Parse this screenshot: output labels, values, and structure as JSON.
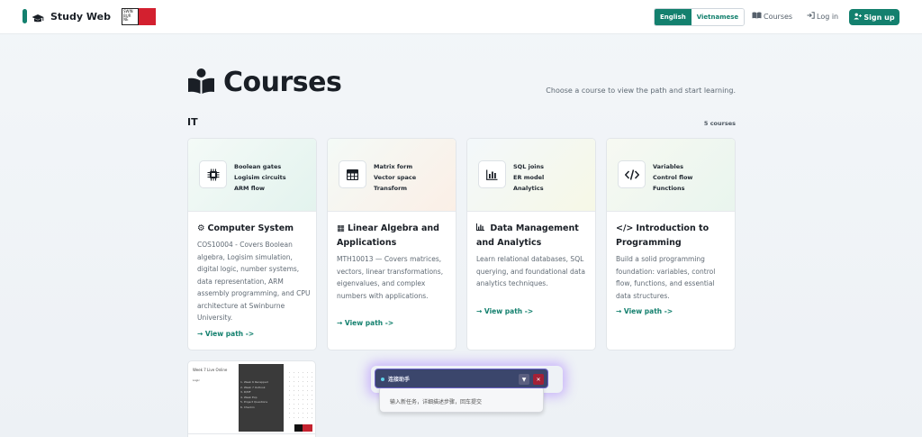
{
  "nav": {
    "brand": "Study Web",
    "logo_text": "SWIN BUR NE",
    "lang_english": "English",
    "lang_vietnamese": "Vietnamese",
    "courses": "Courses",
    "login": "Log in",
    "signup": "Sign up"
  },
  "header": {
    "title": "Courses",
    "subtitle": "Choose a course to view the path and start learning."
  },
  "section": {
    "name": "IT",
    "count": "5 courses"
  },
  "cards": [
    {
      "icon": "chip-icon",
      "tags": [
        "Boolean gates",
        "Logisim circuits",
        "ARM flow"
      ],
      "title_glyph": "⚙",
      "title": "Computer System",
      "description": "COS10004 - Covers Boolean algebra, Logisim simulation, digital logic, number systems, data representation, ARM assembly programming, and CPU architecture at Swinburne University.",
      "link": "View path ->"
    },
    {
      "icon": "table-icon",
      "tags": [
        "Matrix form",
        "Vector space",
        "Transform"
      ],
      "title_glyph": "▦",
      "title": "Linear Algebra and Applications",
      "description": "MTH10013 — Covers matrices, vectors, linear transformations, eigenvalues, and complex numbers with applications.",
      "link": "View path ->"
    },
    {
      "icon": "bar-chart-icon",
      "tags": [
        "SQL joins",
        "ER model",
        "Analytics"
      ],
      "title_glyph": "📊",
      "title": "Data Management and Analytics",
      "description": "Learn relational databases, SQL querying, and foundational data analytics techniques.",
      "link": "View path ->"
    },
    {
      "icon": "code-icon",
      "tags": [
        "Variables",
        "Control flow",
        "Functions"
      ],
      "title_glyph": "</>",
      "title": "Introduction to Programming",
      "description": "Build a solid programming foundation: variables, control flow, functions, and essential data structures.",
      "link": "View path ->"
    }
  ],
  "thumb": {
    "title": "Week 7 Live Online",
    "sub": "Logic",
    "menu": [
      "1. Week 6 Recapped",
      "2. Week 7 Outlook",
      "3. D/MF",
      "4. Week Exp",
      "5. Project Questions",
      "6. Checkin"
    ]
  },
  "widget": {
    "label": "连接助手",
    "placeholder": "输入新任务，详细描述步骤，回车提交",
    "btn_down": "▼",
    "btn_close": "✕"
  },
  "colors": {
    "accent": "#13806e",
    "widget_head": "#3b466c",
    "close": "#a32136"
  }
}
